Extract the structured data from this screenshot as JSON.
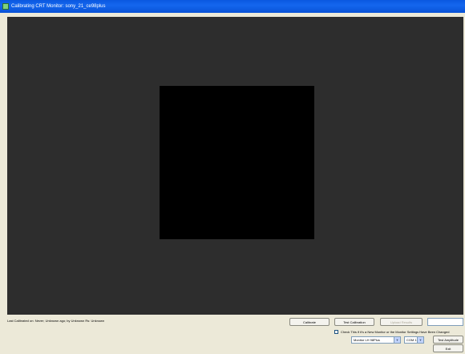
{
  "window": {
    "title": "Calibrating CRT Monitor: sony_21_ce98plus"
  },
  "status": {
    "last_calibrated": "Last Calibrated on: Never; Unknown ago; by Unknown Rs: Unknown"
  },
  "buttons": {
    "calibrate": "Calibrate",
    "test_calibration": "Test Calibration",
    "disabled_action": "Upload Results",
    "test_amplitude": "Test Amplitude",
    "exit": "Exit"
  },
  "checkbox": {
    "label": "Check This if it's a New Monitor or the Monitor Settings Have Been Changed"
  },
  "selects": {
    "monitor": "Monitor LH 98Plus",
    "port": "COM 1"
  },
  "colors": {
    "background": "#2d2d2d",
    "patch": "#000000",
    "titlebar": "#0a58e0"
  }
}
